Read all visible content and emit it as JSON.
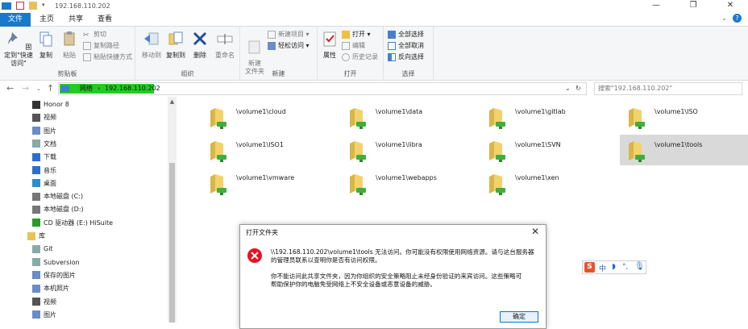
{
  "window": {
    "title": "192.168.110.202",
    "controls": [
      "—",
      "❐",
      "✕"
    ]
  },
  "tabs": [
    "文件",
    "主页",
    "共享",
    "查看"
  ],
  "ribbon": {
    "clipboard": {
      "pin": "固定到\"快速访问\"",
      "copy": "复制",
      "paste": "粘贴",
      "cut": "剪切",
      "copy_path": "复制路径",
      "paste_shortcut": "粘贴快捷方式",
      "label": "剪贴板"
    },
    "organize": {
      "move_to": "移动到",
      "copy_to": "复制到",
      "delete": "删除",
      "rename": "重命名",
      "label": "组织"
    },
    "new": {
      "new_folder": "新建\n文件夹",
      "new_item": "新建项目 ▾",
      "easy_access": "轻松访问 ▾",
      "label": "新建"
    },
    "open": {
      "properties": "属性",
      "open": "打开 ▾",
      "edit": "编辑",
      "history": "历史记录",
      "label": "打开"
    },
    "select": {
      "select_all": "全部选择",
      "select_none": "全部取消",
      "invert": "反向选择",
      "label": "选择"
    }
  },
  "address": {
    "crumbs": [
      "网络",
      "192.168.110.202"
    ],
    "search_placeholder": "搜索\"192.168.110.202\""
  },
  "nav_items": [
    {
      "label": "Honor 8",
      "icon": "phone-icon"
    },
    {
      "label": "视频",
      "icon": "video-icon"
    },
    {
      "label": "图片",
      "icon": "picture-icon"
    },
    {
      "label": "文档",
      "icon": "document-icon"
    },
    {
      "label": "下载",
      "icon": "download-icon"
    },
    {
      "label": "音乐",
      "icon": "music-icon"
    },
    {
      "label": "桌面",
      "icon": "desktop-icon"
    },
    {
      "label": "本地磁盘 (C:)",
      "icon": "drive-icon"
    },
    {
      "label": "本地磁盘 (D:)",
      "icon": "drive-icon"
    },
    {
      "label": "CD 驱动器 (E:) HiSuite",
      "icon": "cd-icon"
    },
    {
      "label": "库",
      "icon": "library-icon"
    },
    {
      "label": "Git",
      "icon": "git-icon"
    },
    {
      "label": "Subversion",
      "icon": "svn-icon"
    },
    {
      "label": "保存的图片",
      "icon": "picture-icon"
    },
    {
      "label": "本机照片",
      "icon": "picture-icon"
    },
    {
      "label": "视频",
      "icon": "video-icon"
    },
    {
      "label": "图片",
      "icon": "picture-icon"
    }
  ],
  "folders": [
    "\\volume1\\cloud",
    "\\volume1\\data",
    "\\volume1\\gitlab",
    "\\volume1\\ISO",
    "\\volume1\\ISO1",
    "\\volume1\\libra",
    "\\volume1\\SVN",
    "\\volume1\\tools",
    "\\volume1\\vmware",
    "\\volume1\\webapps",
    "\\volume1\\xen"
  ],
  "dialog": {
    "title": "打开文件夹",
    "line1": "\\\\192.168.110.202\\volume1\\tools 无法访问。你可能没有权限使用网络资源。请与这台服务器",
    "line2": "的管理员联系以查明你是否有访问权限。",
    "line3": "你不能访问此共享文件夹，因为你组织的安全策略阻止未经身份验证的来宾访问。这些策略可",
    "line4": "帮助保护你的电脑免受网络上不安全设备或恶意设备的威胁。",
    "ok": "确定",
    "close": "✕"
  },
  "ime": {
    "logo": "S",
    "mode": "中"
  },
  "colors": {
    "accent": "#1979ca",
    "selection": "#22cc22",
    "error": "#e81123"
  }
}
